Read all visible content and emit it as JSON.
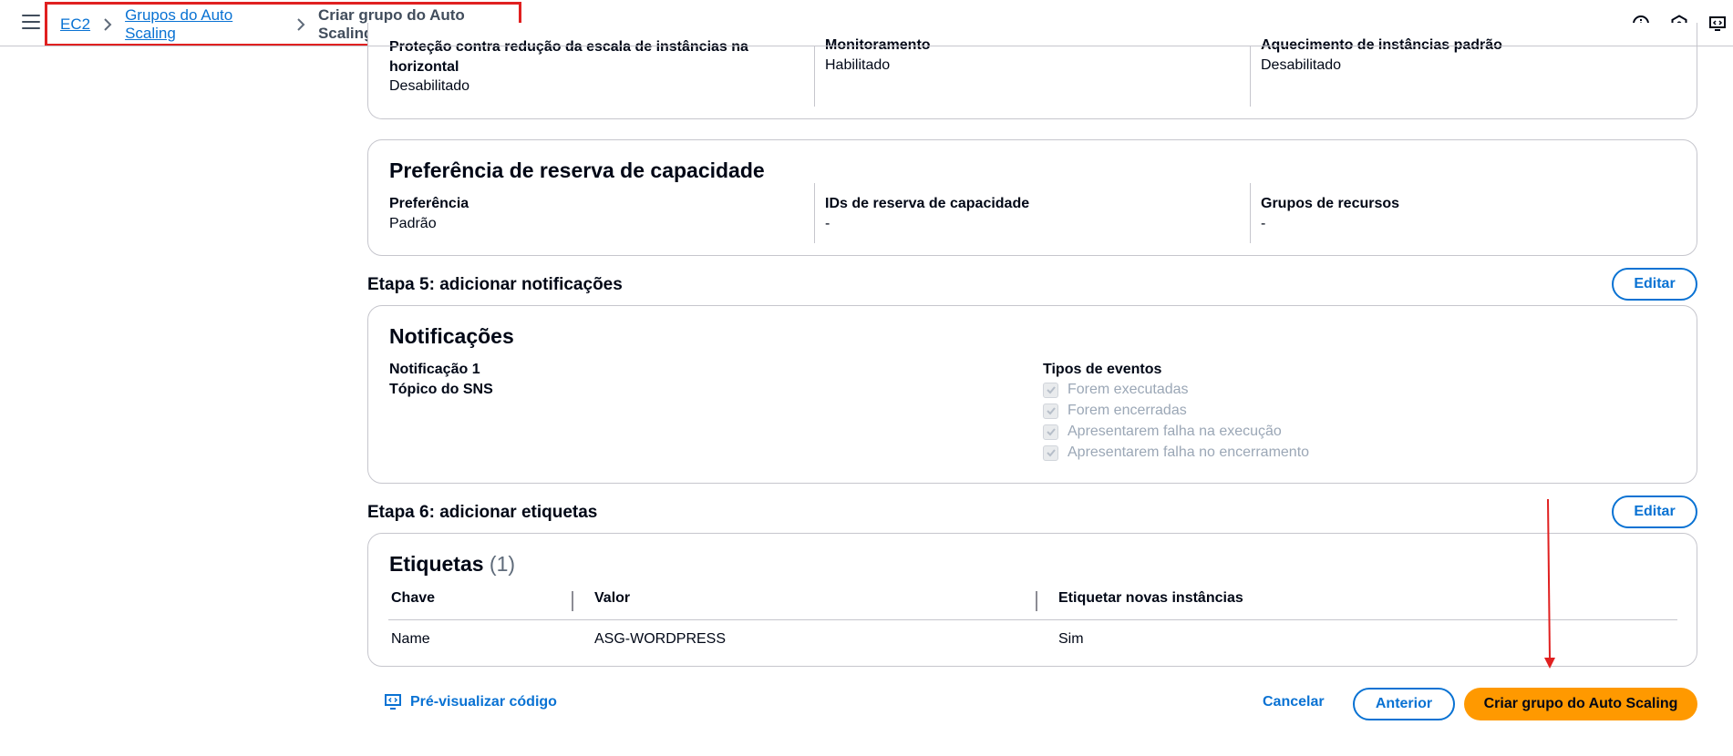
{
  "breadcrumb": {
    "items": [
      "EC2",
      "Grupos do Auto Scaling"
    ],
    "current": "Criar grupo do Auto Scaling"
  },
  "top_card": {
    "col1": {
      "label": "Proteção contra redução da escala de instâncias na horizontal",
      "value": "Desabilitado"
    },
    "col2": {
      "label": "Monitoramento",
      "value": "Habilitado"
    },
    "col3": {
      "label": "Aquecimento de instâncias padrão",
      "value": "Desabilitado"
    }
  },
  "capacity": {
    "title": "Preferência de reserva de capacidade",
    "col1": {
      "label": "Preferência",
      "value": "Padrão"
    },
    "col2": {
      "label": "IDs de reserva de capacidade",
      "value": "-"
    },
    "col3": {
      "label": "Grupos de recursos",
      "value": "-"
    }
  },
  "step5": {
    "heading": "Etapa 5: adicionar notificações",
    "edit_label": "Editar",
    "card_title": "Notificações",
    "notification_label": "Notificação 1",
    "sns_label": "Tópico do SNS",
    "event_types_label": "Tipos de eventos",
    "events": [
      "Forem executadas",
      "Forem encerradas",
      "Apresentarem falha na execução",
      "Apresentarem falha no encerramento"
    ]
  },
  "step6": {
    "heading": "Etapa 6: adicionar etiquetas",
    "edit_label": "Editar",
    "card_title": "Etiquetas",
    "count": "(1)",
    "columns": [
      "Chave",
      "Valor",
      "Etiquetar novas instâncias"
    ],
    "rows": [
      [
        "Name",
        "ASG-WORDPRESS",
        "Sim"
      ]
    ]
  },
  "footer": {
    "preview_label": "Pré-visualizar código",
    "cancel_label": "Cancelar",
    "previous_label": "Anterior",
    "create_label": "Criar grupo do Auto Scaling"
  },
  "colors": {
    "link": "#0972d3",
    "primary_button": "#ff9900",
    "annotation_red": "#e02020"
  },
  "icons": [
    "menu-icon",
    "chevron-right-icon",
    "info-icon",
    "settings-hexagon-icon",
    "code-preview-icon",
    "check-icon"
  ]
}
